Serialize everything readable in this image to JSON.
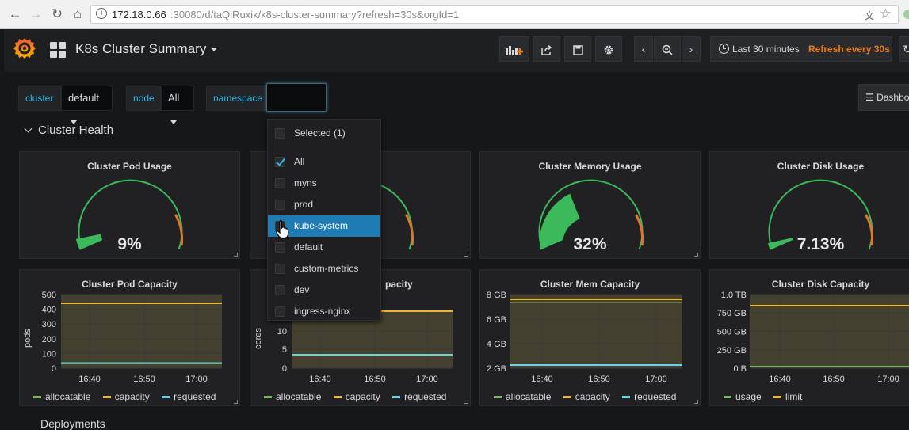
{
  "browser": {
    "url_host": "172.18.0.66",
    "url_path": ":30080/d/taQlRuxik/k8s-cluster-summary?refresh=30s&orgId=1"
  },
  "header": {
    "title": "K8s Cluster Summary",
    "time_range": "Last 30 minutes",
    "refresh": "Refresh every 30s",
    "dashboard_links": "Dashboa"
  },
  "variables": {
    "cluster_label": "cluster",
    "cluster_value": "default",
    "node_label": "node",
    "node_value": "All",
    "namespace_label": "namespace"
  },
  "row": {
    "title": "Cluster Health",
    "next_title": "Deployments"
  },
  "dropdown": {
    "selected_label": "Selected (1)",
    "options": [
      "All",
      "myns",
      "prod",
      "kube-system",
      "default",
      "custom-metrics",
      "dev",
      "ingress-nginx"
    ],
    "checked": "All",
    "highlighted": "kube-system"
  },
  "gauges": [
    {
      "title": "Cluster Pod Usage",
      "value_text": "9%",
      "value": 9
    },
    {
      "title": "Cluster CPU Usage",
      "title_visible": "sage",
      "value_text": "",
      "value": 60
    },
    {
      "title": "Cluster Memory Usage",
      "value_text": "32%",
      "value": 32
    },
    {
      "title": "Cluster Disk Usage",
      "value_text": "7.13%",
      "value": 7.13
    }
  ],
  "capacity_panels": [
    {
      "title": "Cluster Pod Capacity",
      "ylabel": "pods",
      "yticks": [
        "500",
        "400",
        "300",
        "200",
        "100",
        "0"
      ],
      "xticks": [
        "16:40",
        "16:50",
        "17:00"
      ],
      "legend": [
        "allocatable",
        "capacity",
        "requested"
      ]
    },
    {
      "title": "Cluster CPU Capacity",
      "title_visible": "pacity",
      "ylabel": "cores",
      "yticks": [
        "10",
        "5",
        "0"
      ],
      "xticks": [
        "16:40",
        "16:50",
        "17:00"
      ],
      "legend": [
        "allocatable",
        "capacity",
        "requested"
      ]
    },
    {
      "title": "Cluster Mem Capacity",
      "ylabel": "",
      "yticks": [
        "8 GB",
        "6 GB",
        "4 GB",
        "2 GB"
      ],
      "xticks": [
        "16:40",
        "16:50",
        "17:00"
      ],
      "legend": [
        "allocatable",
        "capacity",
        "requested"
      ]
    },
    {
      "title": "Cluster Disk Capacity",
      "ylabel": "",
      "yticks": [
        "1.0 TB",
        "750 GB",
        "500 GB",
        "250 GB",
        "0 B"
      ],
      "xticks": [
        "16:40",
        "16:50",
        "17:00"
      ],
      "legend": [
        "usage",
        "limit"
      ]
    }
  ],
  "colors": {
    "accent": "#33b5e5",
    "refresh": "#eb7b18",
    "series_green": "#7eb26d",
    "series_yellow": "#eab839",
    "series_cyan": "#6ed0e0",
    "gauge_green": "#3cb95a",
    "highlight": "#1f7bb3"
  }
}
